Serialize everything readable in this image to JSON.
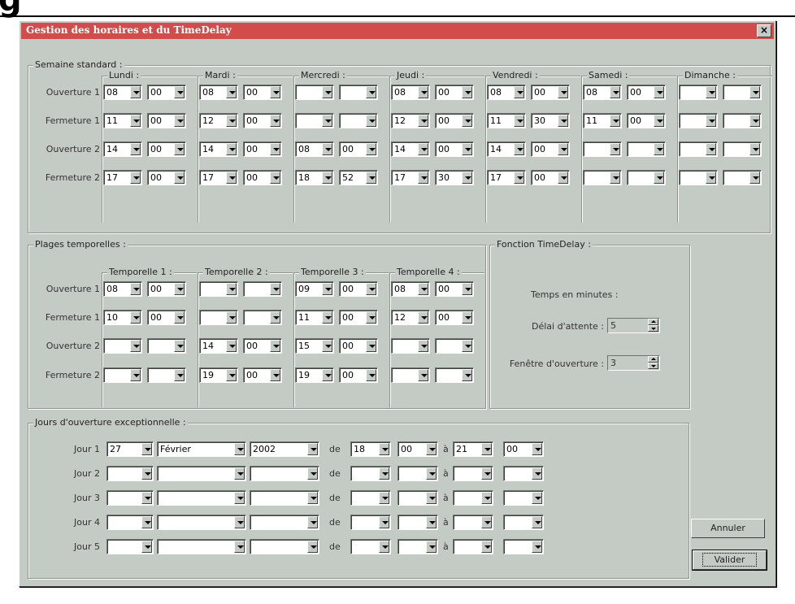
{
  "background_glyph": "g",
  "window": {
    "title": "Gestion des horaires et du TimeDelay",
    "close_label": "×"
  },
  "week": {
    "legend": "Semaine standard :",
    "rows": [
      "Ouverture 1",
      "Fermeture 1",
      "Ouverture 2",
      "Fermeture 2"
    ],
    "days": [
      {
        "label": "Lundi :",
        "values": [
          [
            "08",
            "00"
          ],
          [
            "11",
            "00"
          ],
          [
            "14",
            "00"
          ],
          [
            "17",
            "00"
          ]
        ]
      },
      {
        "label": "Mardi :",
        "values": [
          [
            "08",
            "00"
          ],
          [
            "12",
            "00"
          ],
          [
            "14",
            "00"
          ],
          [
            "17",
            "00"
          ]
        ]
      },
      {
        "label": "Mercredi :",
        "values": [
          [
            "",
            ""
          ],
          [
            "",
            ""
          ],
          [
            "08",
            "00"
          ],
          [
            "18",
            "52"
          ]
        ]
      },
      {
        "label": "Jeudi :",
        "values": [
          [
            "08",
            "00"
          ],
          [
            "12",
            "00"
          ],
          [
            "14",
            "00"
          ],
          [
            "17",
            "30"
          ]
        ]
      },
      {
        "label": "Vendredi :",
        "values": [
          [
            "08",
            "00"
          ],
          [
            "11",
            "30"
          ],
          [
            "14",
            "00"
          ],
          [
            "17",
            "00"
          ]
        ]
      },
      {
        "label": "Samedi :",
        "values": [
          [
            "08",
            "00"
          ],
          [
            "11",
            "00"
          ],
          [
            "",
            ""
          ],
          [
            "",
            ""
          ]
        ]
      },
      {
        "label": "Dimanche :",
        "values": [
          [
            "",
            ""
          ],
          [
            "",
            ""
          ],
          [
            "",
            ""
          ],
          [
            "",
            ""
          ]
        ]
      }
    ]
  },
  "ranges": {
    "legend": "Plages temporelles :",
    "rows": [
      "Ouverture 1",
      "Fermeture 1",
      "Ouverture 2",
      "Fermeture 2"
    ],
    "cols": [
      {
        "label": "Temporelle 1 :",
        "values": [
          [
            "08",
            "00"
          ],
          [
            "10",
            "00"
          ],
          [
            "",
            ""
          ],
          [
            "",
            ""
          ]
        ]
      },
      {
        "label": "Temporelle 2 :",
        "values": [
          [
            "",
            ""
          ],
          [
            "",
            ""
          ],
          [
            "14",
            "00"
          ],
          [
            "19",
            "00"
          ]
        ]
      },
      {
        "label": "Temporelle 3 :",
        "values": [
          [
            "09",
            "00"
          ],
          [
            "11",
            "00"
          ],
          [
            "15",
            "00"
          ],
          [
            "19",
            "00"
          ]
        ]
      },
      {
        "label": "Temporelle 4 :",
        "values": [
          [
            "08",
            "00"
          ],
          [
            "12",
            "00"
          ],
          [
            "",
            ""
          ],
          [
            "",
            ""
          ]
        ]
      }
    ]
  },
  "timedelay": {
    "legend": "Fonction TimeDelay :",
    "unit_label": "Temps en minutes :",
    "delay_label": "Délai d'attente :",
    "delay_value": "5",
    "window_label": "Fenêtre d'ouverture :",
    "window_value": "3"
  },
  "exceptional": {
    "legend": "Jours d'ouverture exceptionnelle :",
    "de_label": "de",
    "a_label": "à",
    "rows": [
      {
        "label": "Jour 1",
        "day": "27",
        "month": "Février",
        "year": "2002",
        "from_h": "18",
        "from_m": "00",
        "to_h": "21",
        "to_m": "00"
      },
      {
        "label": "Jour 2",
        "day": "",
        "month": "",
        "year": "",
        "from_h": "",
        "from_m": "",
        "to_h": "",
        "to_m": ""
      },
      {
        "label": "Jour 3",
        "day": "",
        "month": "",
        "year": "",
        "from_h": "",
        "from_m": "",
        "to_h": "",
        "to_m": ""
      },
      {
        "label": "Jour 4",
        "day": "",
        "month": "",
        "year": "",
        "from_h": "",
        "from_m": "",
        "to_h": "",
        "to_m": ""
      },
      {
        "label": "Jour 5",
        "day": "",
        "month": "",
        "year": "",
        "from_h": "",
        "from_m": "",
        "to_h": "",
        "to_m": ""
      }
    ]
  },
  "buttons": {
    "cancel": "Annuler",
    "ok": "Valider"
  }
}
